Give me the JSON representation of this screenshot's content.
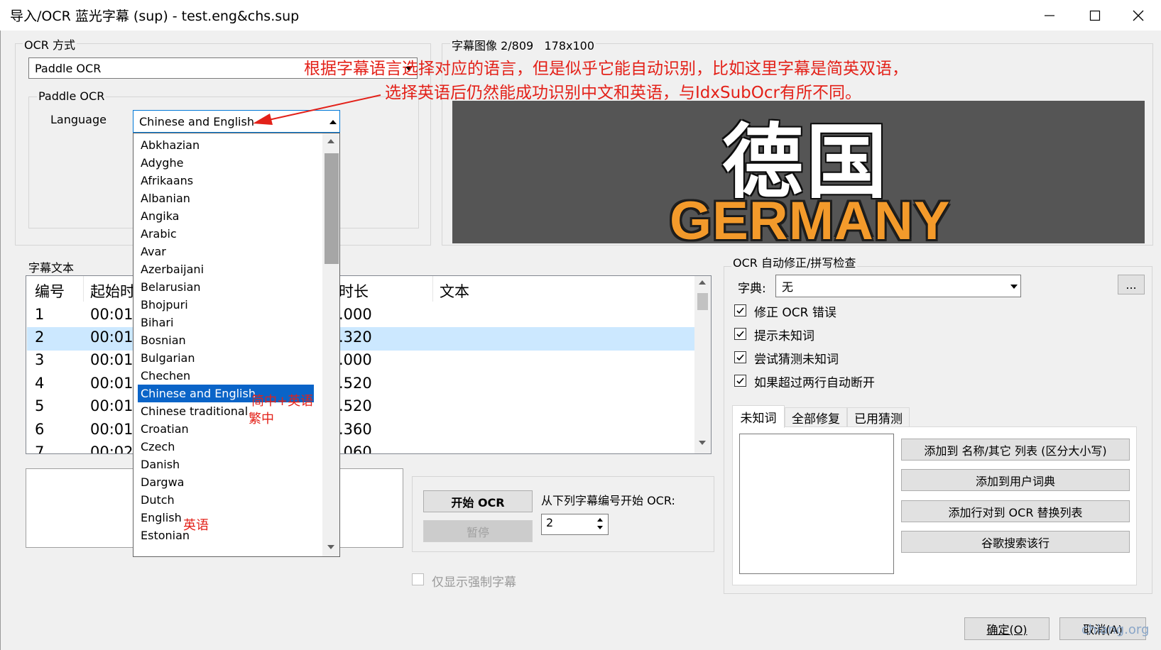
{
  "window": {
    "title": "导入/OCR 蓝光字幕 (sup) - test.eng&chs.sup"
  },
  "ocr_method": {
    "group_label": "OCR 方式",
    "engine_value": "Paddle OCR",
    "sub_group_label": "Paddle OCR",
    "language_label": "Language",
    "language_value": "Chinese and English"
  },
  "language_list": {
    "items": [
      "Abkhazian",
      "Adyghe",
      "Afrikaans",
      "Albanian",
      "Angika",
      "Arabic",
      "Avar",
      "Azerbaijani",
      "Belarusian",
      "Bhojpuri",
      "Bihari",
      "Bosnian",
      "Bulgarian",
      "Chechen",
      "Chinese and English",
      "Chinese traditional",
      "Croatian",
      "Czech",
      "Danish",
      "Dargwa",
      "Dutch",
      "English",
      "Estonian"
    ],
    "selected": "Chinese and English"
  },
  "annotations": {
    "note_line1": "根据字幕语言选择对应的语言，但是似乎它能自动识别，比如这里字幕是简英双语，",
    "note_line2": "选择英语后仍然能成功识别中文和英语，与IdxSubOcr有所不同。",
    "tag_chs_eng": "简中+英语",
    "tag_cht": "繁中",
    "tag_eng": "英语"
  },
  "subtitle_image": {
    "group_label": "字幕图像 2/809   178x100",
    "text_cn": "德国",
    "text_en": "GERMANY"
  },
  "subtitle_text": {
    "group_label": "字幕文本",
    "columns": [
      "编号",
      "起始时",
      "时长",
      "文本"
    ],
    "rows": [
      {
        "num": "1",
        "start": "00:01:",
        "dur": ".000"
      },
      {
        "num": "2",
        "start": "00:01:",
        "dur": ".320"
      },
      {
        "num": "3",
        "start": "00:01:",
        "dur": ".000"
      },
      {
        "num": "4",
        "start": "00:01:",
        "dur": ".520"
      },
      {
        "num": "5",
        "start": "00:01:",
        "dur": ".520"
      },
      {
        "num": "6",
        "start": "00:01:",
        "dur": ".360"
      },
      {
        "num": "7",
        "start": "00:02:",
        "dur": ".060"
      }
    ],
    "selected_row": "2"
  },
  "ocr_controls": {
    "start_button": "开始 OCR",
    "pause_button": "暂停",
    "start_from_label": "从下列字幕编号开始 OCR:",
    "start_from_value": "2",
    "forced_only_label": "仅显示强制字幕"
  },
  "autocorrect": {
    "group_label": "OCR 自动修正/拼写检查",
    "dict_label": "字典:",
    "dict_value": "无",
    "more_button": "...",
    "checks": [
      {
        "label": "修正 OCR 错误",
        "checked": true
      },
      {
        "label": "提示未知词",
        "checked": true
      },
      {
        "label": "尝试猜测未知词",
        "checked": true
      },
      {
        "label": "如果超过两行自动断开",
        "checked": true
      }
    ],
    "tabs": [
      "未知词",
      "全部修复",
      "已用猜测"
    ],
    "actions": [
      "添加到 名称/其它 列表 (区分大小写)",
      "添加到用户词典",
      "添加行对到 OCR 替换列表",
      "谷歌搜索该行"
    ]
  },
  "footer": {
    "ok_button": "确定(O)",
    "cancel_button": "取消(A)",
    "watermark": "chiang.org"
  }
}
